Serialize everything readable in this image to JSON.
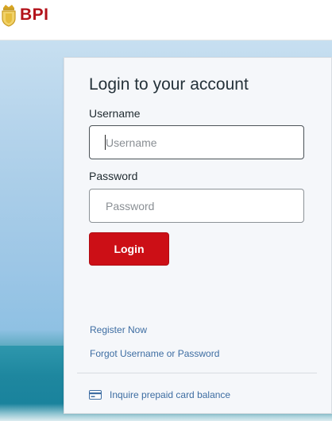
{
  "header": {
    "logo_text": "BPI",
    "brand_color": "#b3121a"
  },
  "login": {
    "title": "Login to your account",
    "username_label": "Username",
    "username_placeholder": "Username",
    "password_label": "Password",
    "password_placeholder": "Password",
    "login_button": "Login",
    "button_color": "#cc0f16"
  },
  "links": {
    "register": "Register Now",
    "forgot": "Forgot Username or Password",
    "prepaid": "Inquire prepaid card balance",
    "link_color": "#3d6da2"
  },
  "icons": {
    "crest": "bank-crest-icon",
    "card": "credit-card-icon"
  }
}
